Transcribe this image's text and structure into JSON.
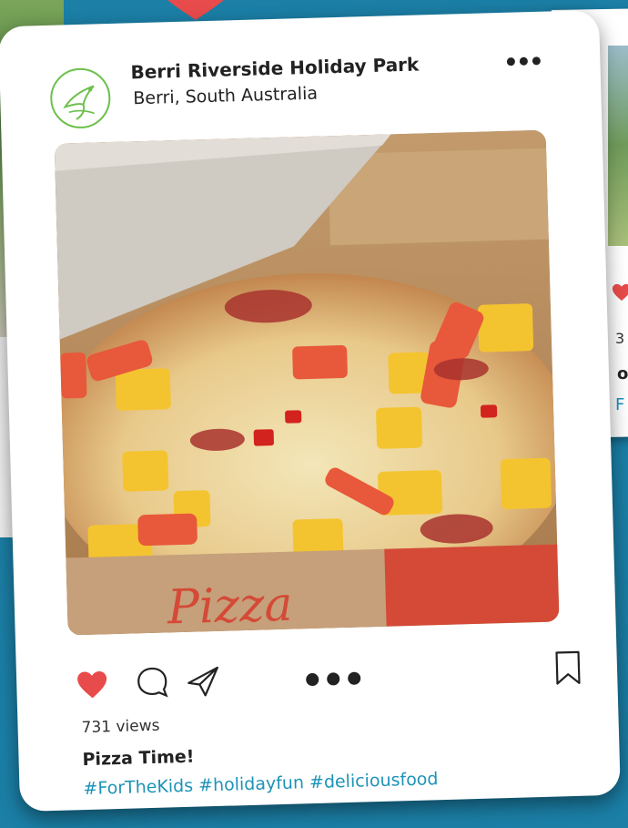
{
  "post": {
    "account_name": "Berri Riverside Holiday Park",
    "location": "Berri, South Australia",
    "image_alt": "Pizza in box",
    "image_box_text": "Pizza",
    "views": "731 views",
    "caption_title": "Pizza Time!",
    "hashtags": "#ForTheKids #holidayfun #deliciousfood",
    "liked": true
  },
  "icons": {
    "avatar": "kingfisher-logo-icon",
    "more": "more-options-icon",
    "like": "heart-icon",
    "comment": "comment-icon",
    "share": "send-icon",
    "save": "bookmark-icon"
  },
  "colors": {
    "background": "#1b7fa6",
    "like_red": "#e84b4b",
    "hashtag": "#1d93b7",
    "logo_green": "#6cc04a"
  },
  "background_card": {
    "views_partial": "3",
    "bold_partial": "o",
    "tag_partial": "F"
  }
}
